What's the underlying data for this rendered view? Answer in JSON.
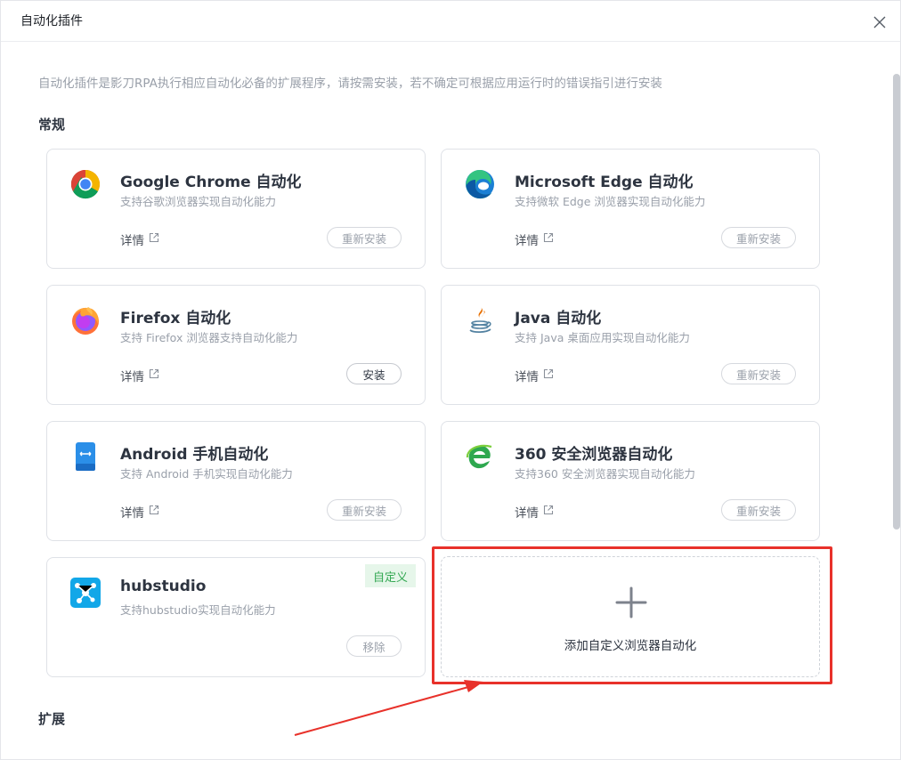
{
  "dialog": {
    "title": "自动化插件",
    "close_icon": "close-icon"
  },
  "description": "自动化插件是影刀RPA执行相应自动化必备的扩展程序，请按需安装，若不确定可根据应用运行时的错误指引进行安装",
  "sections": {
    "general": "常规",
    "extension": "扩展"
  },
  "plugins": [
    {
      "icon": "chrome-icon",
      "title": "Google Chrome 自动化",
      "desc": "支持谷歌浏览器实现自动化能力",
      "detail": "详情",
      "action": "重新安装"
    },
    {
      "icon": "edge-icon",
      "title": "Microsoft Edge 自动化",
      "desc": "支持微软 Edge 浏览器实现自动化能力",
      "detail": "详情",
      "action": "重新安装"
    },
    {
      "icon": "firefox-icon",
      "title": "Firefox 自动化",
      "desc": "支持 Firefox 浏览器支持自动化能力",
      "detail": "详情",
      "action": "安装"
    },
    {
      "icon": "java-icon",
      "title": "Java 自动化",
      "desc": "支持 Java 桌面应用实现自动化能力",
      "detail": "详情",
      "action": "重新安装"
    },
    {
      "icon": "android-icon",
      "title": "Android 手机自动化",
      "desc": "支持 Android 手机实现自动化能力",
      "detail": "详情",
      "action": "重新安装"
    },
    {
      "icon": "360-browser-icon",
      "title": "360 安全浏览器自动化",
      "desc": "支持360 安全浏览器实现自动化能力",
      "detail": "详情",
      "action": "重新安装"
    },
    {
      "icon": "hubstudio-icon",
      "title": "hubstudio",
      "desc": "支持hubstudio实现自动化能力",
      "tag": "自定义",
      "action": "移除"
    }
  ],
  "add_custom": {
    "icon": "plus-icon",
    "label": "添加自定义浏览器自动化"
  },
  "colors": {
    "accent_red": "#e8312a",
    "tag_green": "#34a853",
    "tag_bg": "#e6f6ea"
  }
}
